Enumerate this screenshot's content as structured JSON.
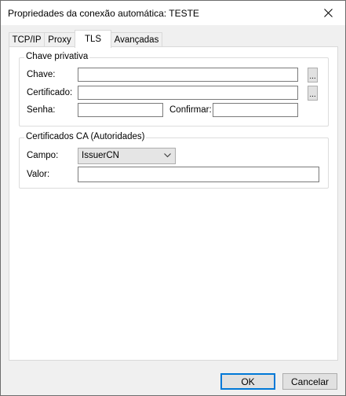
{
  "window": {
    "title": "Propriedades da conexão automática: TESTE"
  },
  "tabs": [
    {
      "label": "TCP/IP"
    },
    {
      "label": "Proxy"
    },
    {
      "label": "TLS"
    },
    {
      "label": "Avançadas"
    }
  ],
  "active_tab": "TLS",
  "private_key_group": {
    "legend": "Chave privativa",
    "key_label": "Chave:",
    "key_value": "",
    "certificate_label": "Certificado:",
    "certificate_value": "",
    "password_label": "Senha:",
    "password_value": "",
    "confirm_label": "Confirmar:",
    "confirm_value": "",
    "browse_label": "..."
  },
  "ca_group": {
    "legend": "Certificados CA (Autoridades)",
    "field_label": "Campo:",
    "field_selected": "IssuerCN",
    "value_label": "Valor:",
    "value_value": ""
  },
  "buttons": {
    "ok": "OK",
    "cancel": "Cancelar"
  },
  "colors": {
    "accent": "#0078d7",
    "panel": "#ffffff",
    "window_bg": "#f0f0f0"
  }
}
